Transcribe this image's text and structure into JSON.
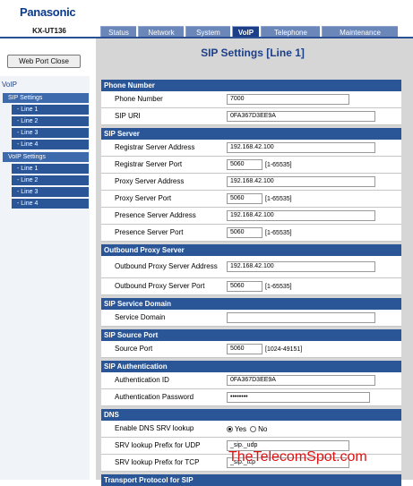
{
  "brand": {
    "logo": "Panasonic",
    "model": "KX-UT136"
  },
  "tabs": [
    "Status",
    "Network",
    "System",
    "VoIP",
    "Telephone",
    "Maintenance"
  ],
  "nav": {
    "close_button": "Web Port Close",
    "voip_label": "VoIP",
    "sip_settings": "SIP Settings",
    "sip_lines": [
      "- Line 1",
      "- Line 2",
      "- Line 3",
      "- Line 4"
    ],
    "voip_settings": "VoIP Settings",
    "voip_lines": [
      "- Line 1",
      "- Line 2",
      "- Line 3",
      "- Line 4"
    ]
  },
  "page": {
    "title": "SIP Settings [Line 1]"
  },
  "sections": {
    "phone_number": {
      "title": "Phone Number",
      "phone_number_label": "Phone Number",
      "phone_number_value": "7000",
      "sip_uri_label": "SIP URI",
      "sip_uri_value": "0FA367D3EE9A"
    },
    "sip_server": {
      "title": "SIP Server",
      "registrar_addr_label": "Registrar Server Address",
      "registrar_addr_value": "192.168.42.100",
      "registrar_port_label": "Registrar Server Port",
      "registrar_port_value": "5060",
      "proxy_addr_label": "Proxy Server Address",
      "proxy_addr_value": "192.168.42.100",
      "proxy_port_label": "Proxy Server Port",
      "proxy_port_value": "5060",
      "presence_addr_label": "Presence Server Address",
      "presence_addr_value": "192.168.42.100",
      "presence_port_label": "Presence Server Port",
      "presence_port_value": "5060",
      "port_range": "[1-65535]"
    },
    "outbound_proxy": {
      "title": "Outbound Proxy Server",
      "addr_label": "Outbound Proxy Server Address",
      "addr_value": "192.168.42.100",
      "port_label": "Outbound Proxy Server Port",
      "port_value": "5060",
      "port_range": "[1-65535]"
    },
    "service_domain": {
      "title": "SIP Service Domain",
      "label": "Service Domain",
      "value": ""
    },
    "source_port": {
      "title": "SIP Source Port",
      "label": "Source Port",
      "value": "5060",
      "range": "[1024-49151]"
    },
    "authentication": {
      "title": "SIP Authentication",
      "id_label": "Authentication ID",
      "id_value": "0FA367D3EE9A",
      "password_label": "Authentication Password",
      "password_value": "••••••••"
    },
    "dns": {
      "title": "DNS",
      "srv_label": "Enable DNS SRV lookup",
      "yes": "Yes",
      "no": "No",
      "udp_label": "SRV lookup Prefix for UDP",
      "udp_value": "_sip._udp",
      "tcp_label": "SRV lookup Prefix for TCP",
      "tcp_value": "_sip._tcp"
    },
    "transport": {
      "title": "Transport Protocol for SIP"
    }
  },
  "watermark": "TheTelecomSpot.com"
}
